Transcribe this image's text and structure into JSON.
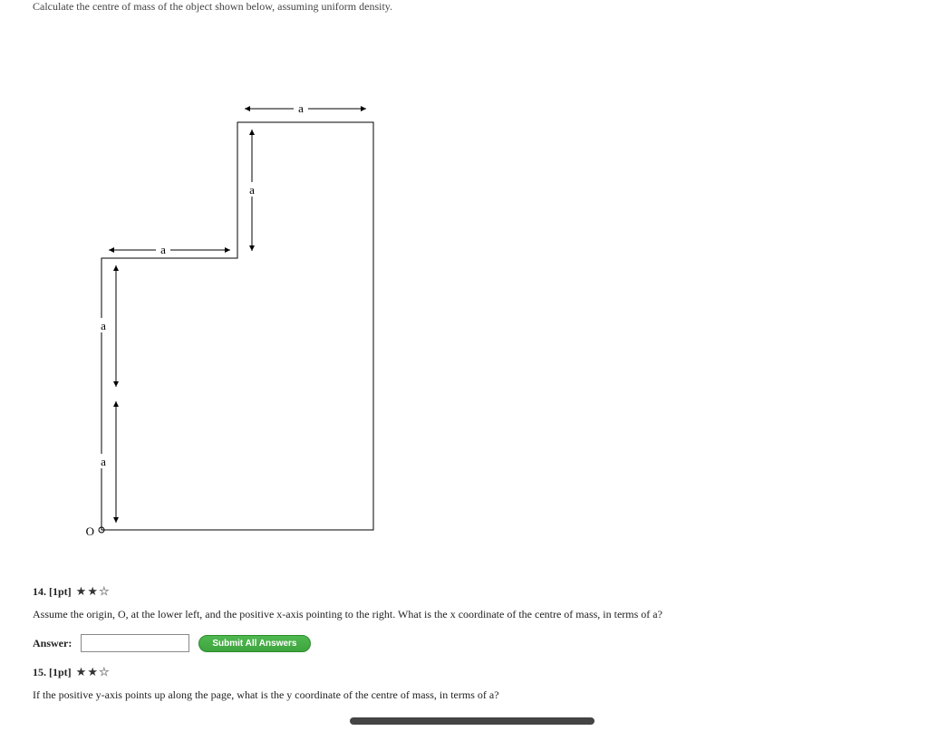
{
  "intro": "Calculate the centre of mass of the object shown below, assuming uniform density.",
  "figure": {
    "label_a": "a",
    "origin_label": "O"
  },
  "questions": [
    {
      "number": "14.",
      "points": "[1pt]",
      "stars_filled": 2,
      "stars_empty": 1,
      "text": "Assume the origin, O, at the lower left, and the positive x-axis pointing to the right. What is the x coordinate of the centre of mass, in terms of a?",
      "answer_label": "Answer:",
      "answer_value": ""
    },
    {
      "number": "15.",
      "points": "[1pt]",
      "stars_filled": 2,
      "stars_empty": 1,
      "text": "If the positive y-axis points up along the page, what is the y coordinate of the centre of mass, in terms of a?"
    }
  ],
  "submit_label": "Submit All Answers"
}
